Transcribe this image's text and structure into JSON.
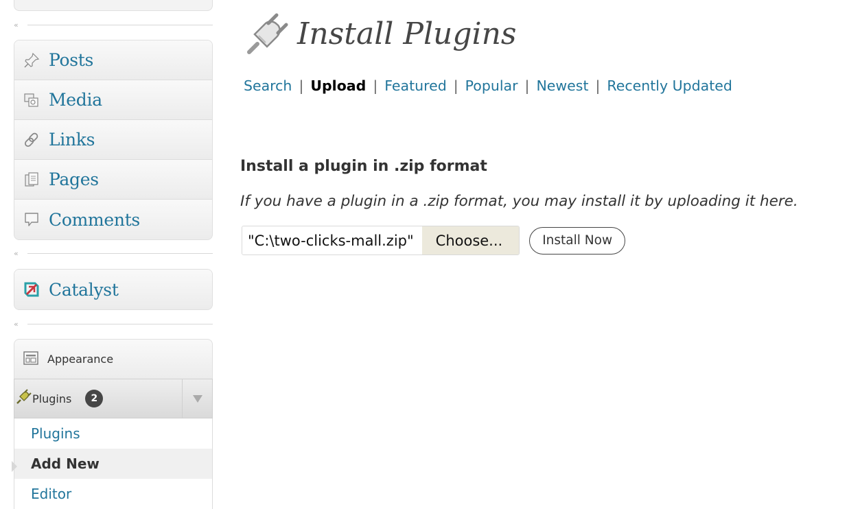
{
  "sidebar": {
    "group1": [
      {
        "label": "Posts",
        "icon": "pushpin-icon"
      },
      {
        "label": "Media",
        "icon": "media-icon"
      },
      {
        "label": "Links",
        "icon": "link-icon"
      },
      {
        "label": "Pages",
        "icon": "pages-icon"
      },
      {
        "label": "Comments",
        "icon": "comment-icon"
      }
    ],
    "collapse_glyph": "«",
    "catalyst": {
      "label": "Catalyst",
      "icon": "catalyst-icon"
    },
    "appearance": {
      "label": "Appearance",
      "icon": "appearance-icon"
    },
    "plugins": {
      "label": "Plugins",
      "icon": "plugin-icon",
      "badge": "2",
      "submenu": [
        {
          "label": "Plugins",
          "current": false
        },
        {
          "label": "Add New",
          "current": true
        },
        {
          "label": "Editor",
          "current": false
        }
      ]
    }
  },
  "main": {
    "title": "Install Plugins",
    "tabs": [
      {
        "label": "Search",
        "current": false
      },
      {
        "label": "Upload",
        "current": true
      },
      {
        "label": "Featured",
        "current": false
      },
      {
        "label": "Popular",
        "current": false
      },
      {
        "label": "Newest",
        "current": false
      },
      {
        "label": "Recently Updated",
        "current": false
      }
    ],
    "tab_separator": "|",
    "section_heading": "Install a plugin in .zip format",
    "section_description": "If you have a plugin in a .zip format, you may install it by uploading it here.",
    "file_input_value": "\"C:\\two-clicks-mall.zip\"",
    "choose_label": "Choose...",
    "install_label": "Install Now"
  },
  "colors": {
    "link": "#21759b",
    "menu_bg": "#f1f1f1",
    "badge_bg": "#464646",
    "choose_bg": "#ece9dc"
  }
}
